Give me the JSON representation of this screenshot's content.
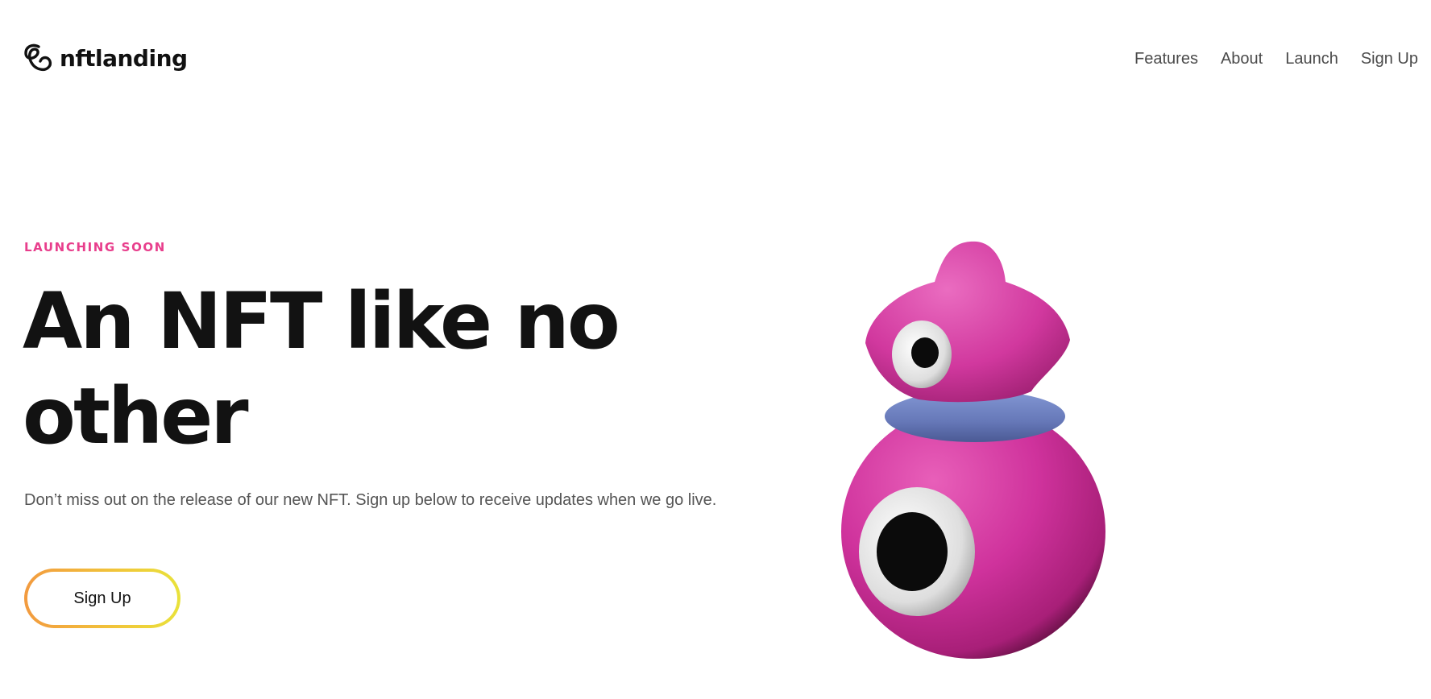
{
  "header": {
    "logo_text": "nftlanding",
    "logo_icon": "swirl-logo-icon",
    "nav": [
      {
        "label": "Features"
      },
      {
        "label": "About"
      },
      {
        "label": "Launch"
      },
      {
        "label": "Sign Up"
      }
    ]
  },
  "hero": {
    "eyebrow": "LAUNCHING SOON",
    "headline": "An NFT like no other",
    "description": "Don’t miss out on the release of our new NFT. Sign up below to receive updates when we go live.",
    "cta_label": "Sign Up"
  },
  "colors": {
    "accent_pink": "#e83e8c",
    "headline": "#121212",
    "cta_gradient_start": "#f29a3f",
    "cta_gradient_end": "#e9e23a",
    "character_body": "#d1389e",
    "character_collar": "#6678b8"
  }
}
